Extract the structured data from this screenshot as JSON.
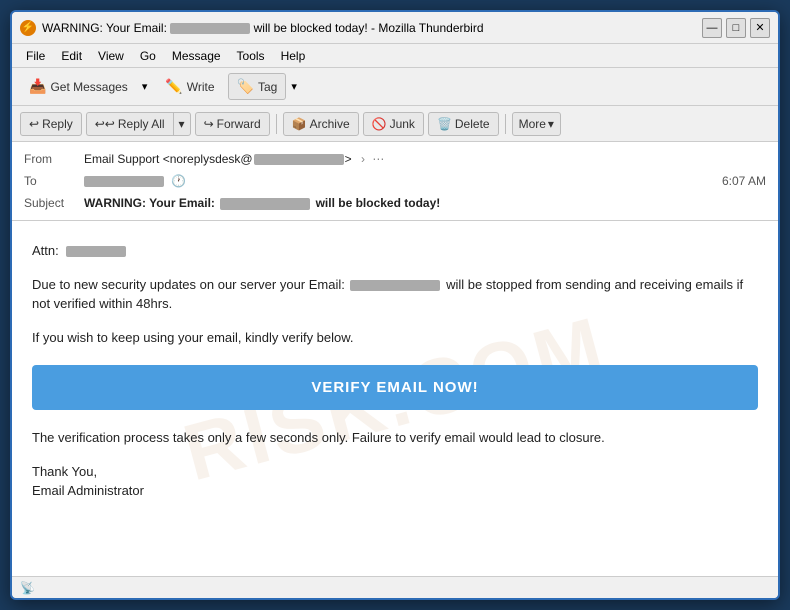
{
  "window": {
    "title": "WARNING: Your Email:         will be blocked today! - Mozilla Thunderbird",
    "title_visible": "WARNING: Your Email:",
    "title_blurred": "                 ",
    "title_suffix": " will be blocked today! - Mozilla Thunderbird",
    "icon": "⚡"
  },
  "menu": {
    "items": [
      "File",
      "Edit",
      "View",
      "Go",
      "Message",
      "Tools",
      "Help"
    ]
  },
  "toolbar": {
    "get_messages_label": "Get Messages",
    "write_label": "Write",
    "tag_label": "Tag"
  },
  "actions": {
    "reply_label": "Reply",
    "reply_all_label": "Reply All",
    "forward_label": "Forward",
    "archive_label": "Archive",
    "junk_label": "Junk",
    "delete_label": "Delete",
    "more_label": "More"
  },
  "email_header": {
    "from_label": "From",
    "from_name": "Email Support <noreplysdesk@",
    "from_blurred": "               ",
    "from_suffix": ">",
    "to_label": "To",
    "to_blurred": "               ",
    "time": "6:07 AM",
    "subject_label": "Subject",
    "subject_prefix": "WARNING: Your Email: ",
    "subject_blurred": "                     ",
    "subject_suffix": " will be blocked today!"
  },
  "email_body": {
    "attn_label": "Attn:",
    "attn_blurred": "      ",
    "paragraph1_prefix": "Due to new security updates on our server your Email: ",
    "paragraph1_blurred": "               ",
    "paragraph1_suffix": " will be stopped from sending and receiving emails if not verified within 48hrs.",
    "paragraph2": "If you wish to keep using your email, kindly verify below.",
    "verify_btn_label": "VERIFY EMAIL NOW!",
    "paragraph3": "The verification process takes only a few seconds only. Failure to verify email would lead to closure.",
    "sign_off": "Thank You,",
    "signature": "Email Administrator"
  },
  "watermark": {
    "text": "RISK.COM"
  },
  "status_bar": {
    "icon": "📡",
    "text": ""
  },
  "window_controls": {
    "minimize": "—",
    "maximize": "□",
    "close": "✕"
  }
}
